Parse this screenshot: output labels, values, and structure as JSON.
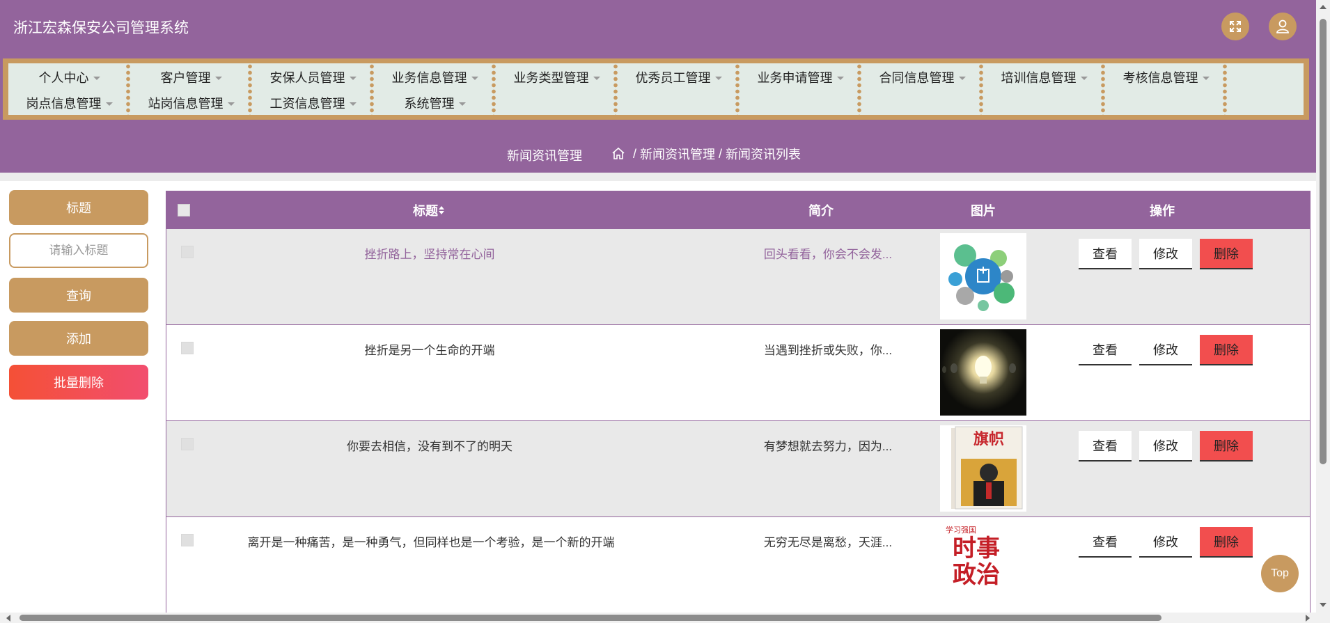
{
  "app": {
    "title": "浙江宏森保安公司管理系统"
  },
  "header": {
    "fullscreen_icon": "fullscreen-icon",
    "user_icon": "user-icon"
  },
  "nav": {
    "row1": [
      "个人中心",
      "客户管理",
      "安保人员管理",
      "业务信息管理",
      "业务类型管理",
      "优秀员工管理",
      "业务申请管理",
      "合同信息管理",
      "培训信息管理",
      "考核信息管理"
    ],
    "row2": [
      "岗点信息管理",
      "站岗信息管理",
      "工资信息管理",
      "系统管理"
    ]
  },
  "breadcrumb": {
    "page_title": "新闻资讯管理",
    "home_icon": "home-icon",
    "path": [
      "新闻资讯管理",
      "新闻资讯列表"
    ],
    "separator": " / "
  },
  "sidebar": {
    "title_label": "标题",
    "search_placeholder": "请输入标题",
    "query_button": "查询",
    "add_button": "添加",
    "batch_delete_button": "批量删除"
  },
  "table": {
    "headers": {
      "title": "标题",
      "sort_icon": "sort-icon",
      "summary": "简介",
      "image": "图片",
      "actions": "操作"
    },
    "action_labels": {
      "view": "查看",
      "edit": "修改",
      "delete": "删除"
    },
    "rows": [
      {
        "title": "挫折路上，坚持常在心间",
        "summary": "回头看看，你会不会发...",
        "image": "bubble-infographic",
        "highlighted": true
      },
      {
        "title": "挫折是另一个生命的开端",
        "summary": "当遇到挫折或失败，你...",
        "image": "glowing-lightbulb"
      },
      {
        "title": "你要去相信，没有到不了的明天",
        "summary": "有梦想就去努力，因为...",
        "image": "magazine-cover",
        "image_text": "旗帜"
      },
      {
        "title": "离开是一种痛苦，是一种勇气，但同样也是一个考验，是一个新的开端",
        "summary": "无穷无尽是离愁，天涯...",
        "image": "current-affairs-cover",
        "image_text_1": "时事",
        "image_text_2": "政治",
        "image_badge": "学习强国"
      }
    ]
  },
  "top_button": "Top",
  "colors": {
    "primary": "#93649c",
    "accent": "#c89a60",
    "danger": "#f24e4e",
    "nav_bg": "#e2ebe6"
  }
}
